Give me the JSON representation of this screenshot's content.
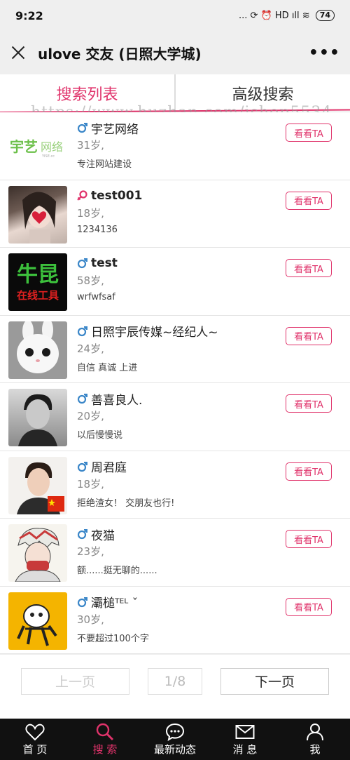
{
  "status": {
    "time": "9:22",
    "icons_text": "... ⟳ ⏰ HD ıll ≋",
    "battery": "74"
  },
  "header": {
    "title": "ulove 交友 (日照大学城)",
    "more": "•••"
  },
  "tabs": [
    {
      "label": "搜索列表"
    },
    {
      "label": "高级搜索"
    }
  ],
  "watermark": "https://www.huzhan.com/ishop5534",
  "users": [
    {
      "name": "宇艺网络",
      "age": "31岁,",
      "sig": "专注网站建设",
      "gender": "male",
      "button": "看看TA",
      "avatar": "宇艺网络"
    },
    {
      "name": "test001",
      "age": "18岁,",
      "sig": "1234136",
      "gender": "female",
      "button": "看看TA",
      "avatar": ""
    },
    {
      "name": "test",
      "age": "58岁,",
      "sig": "wrfwfsaf",
      "gender": "male",
      "button": "看看TA",
      "avatar_line1": "牛昆",
      "avatar_line2": "在线工具"
    },
    {
      "name": "日照宇辰传媒~经纪人~",
      "age": "24岁,",
      "sig": "自信 真诚 上进",
      "gender": "male",
      "button": "看看TA",
      "avatar": ""
    },
    {
      "name": "善喜良人.",
      "age": "20岁,",
      "sig": "以后慢慢说",
      "gender": "male",
      "button": "看看TA",
      "avatar": ""
    },
    {
      "name": "周君庭",
      "age": "18岁,",
      "sig": "拒绝渣女！ 交朋友也行!",
      "gender": "male",
      "button": "看看TA",
      "avatar": ""
    },
    {
      "name": "夜猫",
      "age": "23岁,",
      "sig": "额......挺无聊的......",
      "gender": "male",
      "button": "看看TA",
      "avatar": ""
    },
    {
      "name": "灞槌ᵀᴱᴸ ˇ",
      "age": "30岁,",
      "sig": "不要超过100个字",
      "gender": "male",
      "button": "看看TA",
      "avatar": ""
    }
  ],
  "pager": {
    "prev": "上一页",
    "page": "1/8",
    "next": "下一页"
  },
  "nav": [
    {
      "label": "首 页",
      "icon": "heart-icon"
    },
    {
      "label": "搜 索",
      "icon": "search-icon"
    },
    {
      "label": "最新动态",
      "icon": "chat-bubble-icon"
    },
    {
      "label": "消 息",
      "icon": "envelope-icon"
    },
    {
      "label": "我",
      "icon": "person-icon"
    }
  ],
  "colors": {
    "accent": "#e0336b",
    "male": "#3a86c8",
    "female": "#e0336b"
  }
}
